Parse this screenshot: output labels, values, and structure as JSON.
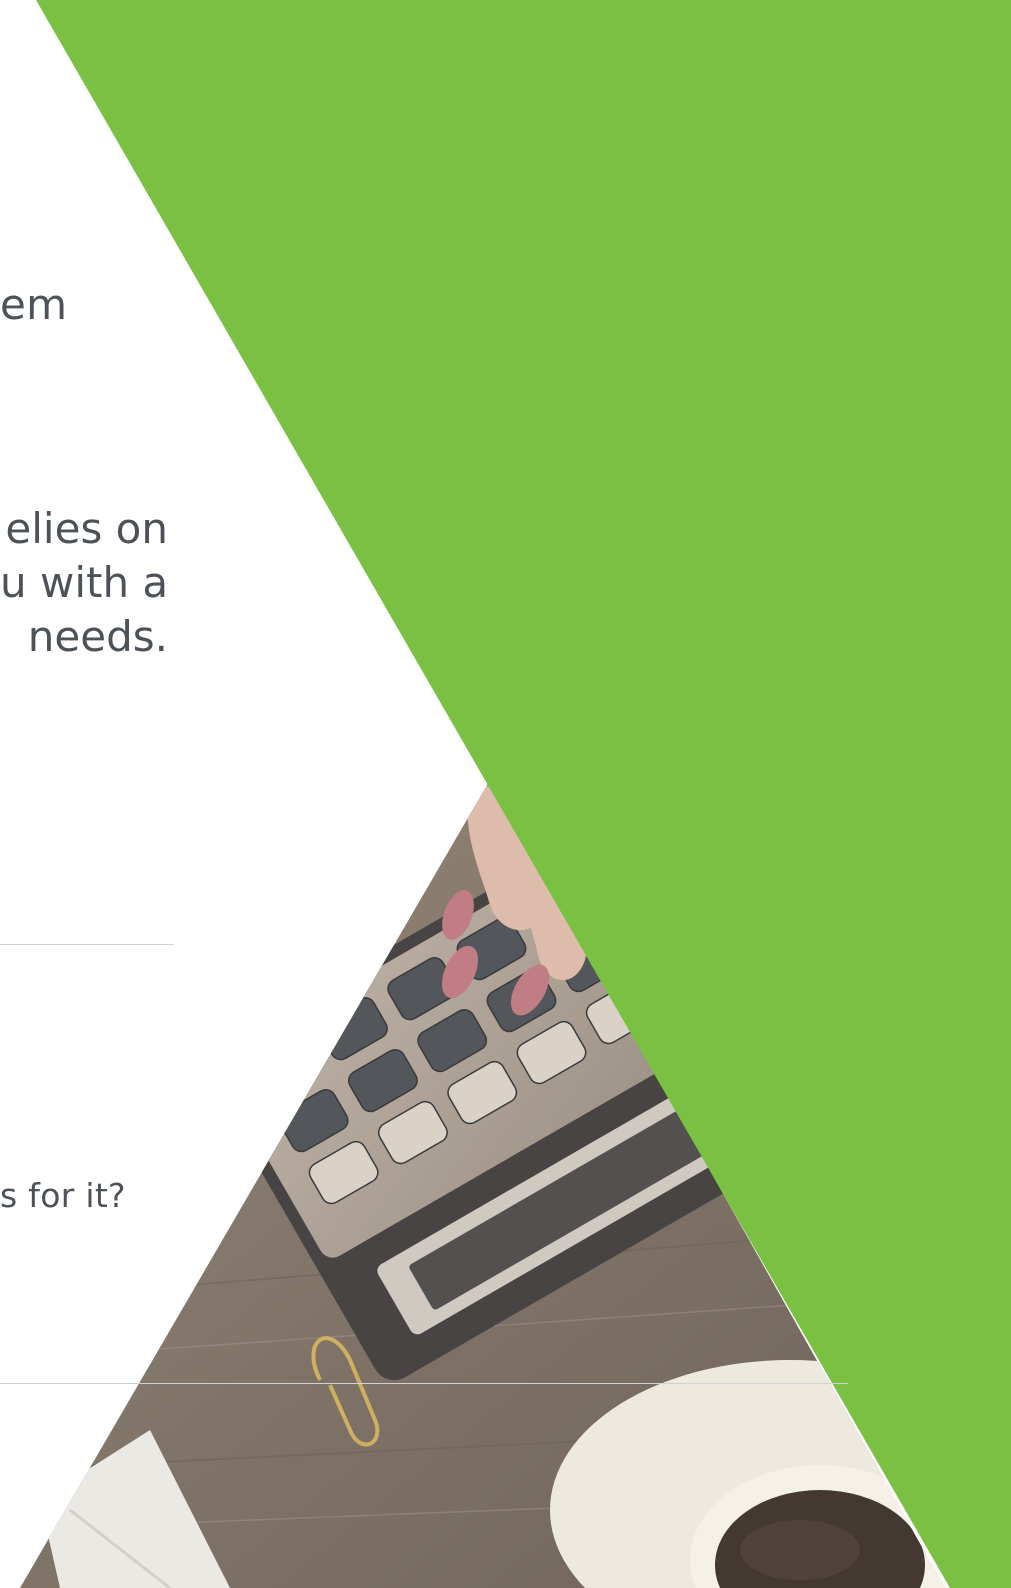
{
  "text": {
    "fragment_top": "em",
    "paragraph_lines": [
      "elies on",
      "u with a",
      "needs."
    ],
    "fragment_question": "s for it?"
  },
  "colors": {
    "brand_green": "#7ac043",
    "text_gray": "#4d5259",
    "divider": "#cfd3d8",
    "background": "#ffffff"
  },
  "image": {
    "description_icon": "calculator-photo",
    "subject": "hand typing on calculator beside coffee cup"
  }
}
